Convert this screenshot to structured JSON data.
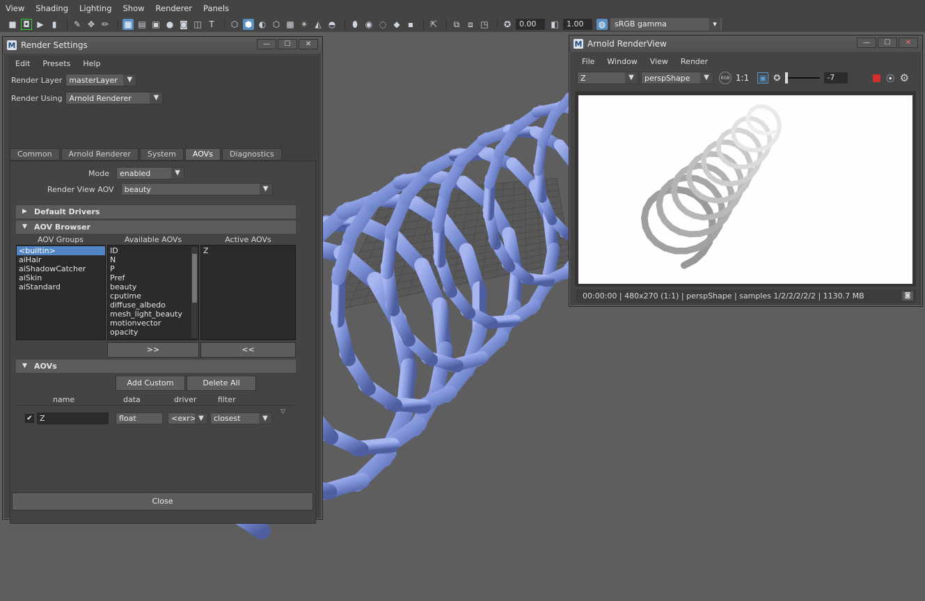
{
  "menubar": {
    "items": [
      "View",
      "Shading",
      "Lighting",
      "Show",
      "Renderer",
      "Panels"
    ]
  },
  "toolbar": {
    "value1": "0.00",
    "value2": "1.00",
    "colorspace": "sRGB gamma"
  },
  "render_settings": {
    "title": "Render Settings",
    "menus": [
      "Edit",
      "Presets",
      "Help"
    ],
    "render_layer_label": "Render Layer",
    "render_layer_value": "masterLayer",
    "render_using_label": "Render Using",
    "render_using_value": "Arnold Renderer",
    "tabs": [
      "Common",
      "Arnold Renderer",
      "System",
      "AOVs",
      "Diagnostics"
    ],
    "mode_label": "Mode",
    "mode_value": "enabled",
    "rv_aov_label": "Render View AOV",
    "rv_aov_value": "beauty",
    "section_default_drivers": "Default Drivers",
    "section_aov_browser": "AOV Browser",
    "aov_groups_header": "AOV Groups",
    "available_aovs_header": "Available AOVs",
    "active_aovs_header": "Active AOVs",
    "aov_groups": [
      "<builtin>",
      "aiHair",
      "aiShadowCatcher",
      "aiSkin",
      "aiStandard"
    ],
    "available_aovs": [
      "ID",
      "N",
      "P",
      "Pref",
      "beauty",
      "cputime",
      "diffuse_albedo",
      "mesh_light_beauty",
      "motionvector",
      "opacity"
    ],
    "active_aovs": [
      "Z"
    ],
    "add_label": ">>",
    "remove_label": "<<",
    "section_aovs": "AOVs",
    "add_custom_label": "Add Custom",
    "delete_all_label": "Delete All",
    "col_name": "name",
    "col_data": "data",
    "col_driver": "driver",
    "col_filter": "filter",
    "aov_row": {
      "name": "Z",
      "data": "float",
      "driver": "<exr>",
      "filter": "closest"
    },
    "close_label": "Close"
  },
  "render_view": {
    "title": "Arnold RenderView",
    "menus": [
      "File",
      "Window",
      "View",
      "Render"
    ],
    "aov_value": "Z",
    "camera_value": "perspShape",
    "rgb_label": "RGB",
    "ratio_label": "1:1",
    "exposure_value": "-7",
    "status": "00:00:00 | 480x270 (1:1) | perspShape  | samples 1/2/2/2/2/2 | 1130.7 MB"
  },
  "colors": {
    "accent": "#5285c5",
    "helix": "#7b8fd6"
  }
}
